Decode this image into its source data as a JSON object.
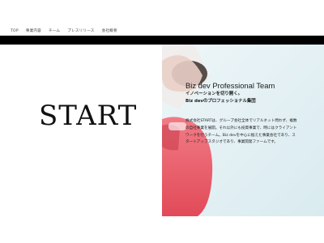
{
  "nav": {
    "items": [
      "TOP",
      "事業内容",
      "チーム",
      "プレスリリース",
      "会社概要"
    ]
  },
  "brand": {
    "logo_text": "START"
  },
  "team": {
    "title": "Biz dev Professional Team",
    "subtitle_line1": "イノベーションを切り開く。",
    "subtitle_line2": "Biz devのプロフェッショナル集団",
    "description": "株式会社STARTは、グループ会社全体でリアルネット問わず、複数の自社事業を展開。それ以外にも投資事業で、時にはクライアントワークを行うチーム。Biz devを中心に据えた事業会社であり、スタートアップスタジオであり、事業開発ファームです。"
  },
  "colors": {
    "nav_bg": "#ffffff",
    "bar": "#000000",
    "hero_bg": "#e6f1f4",
    "hero_accent": "#e4525f"
  }
}
